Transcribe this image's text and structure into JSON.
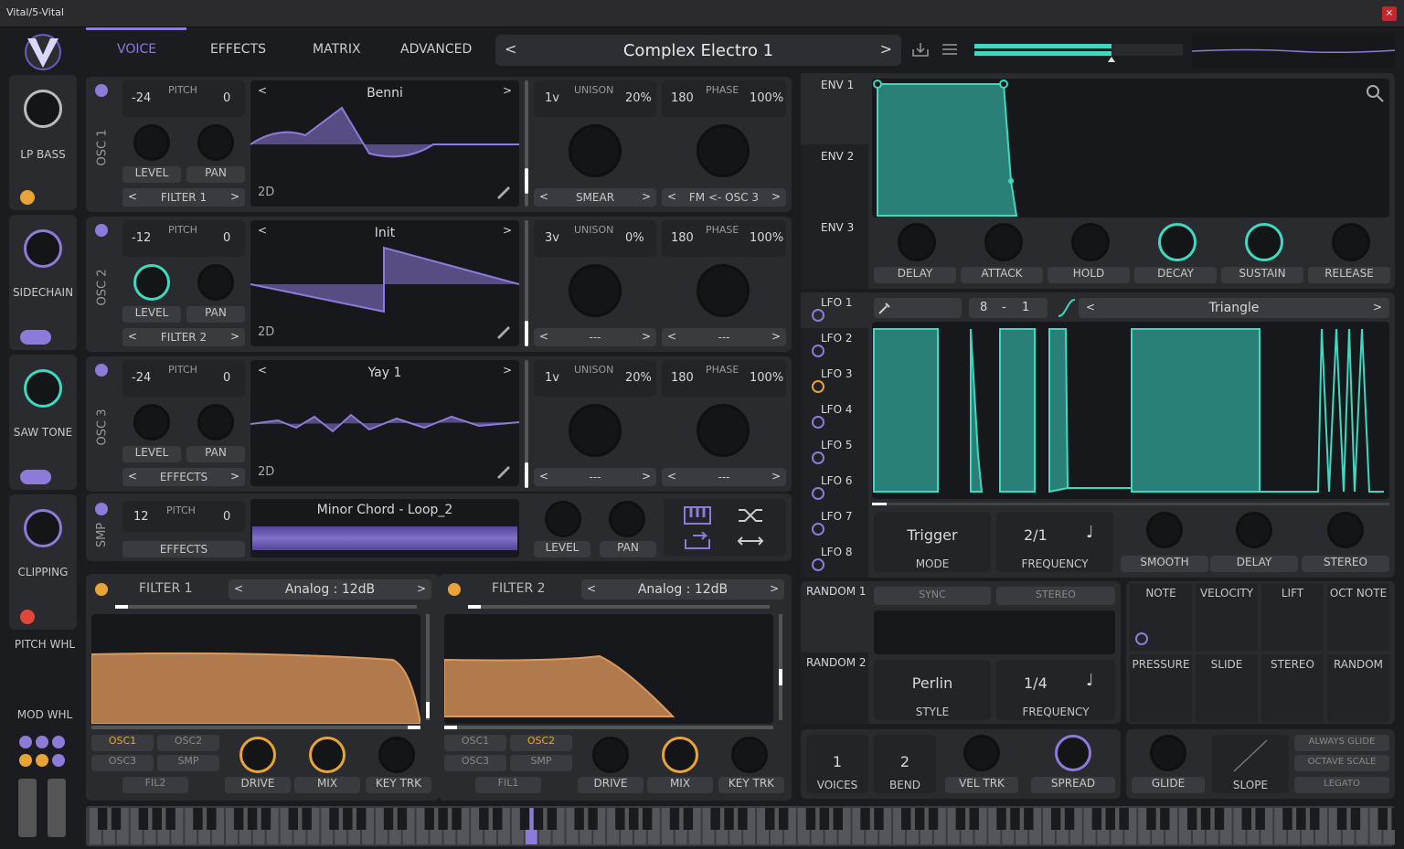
{
  "window": {
    "title": "Vital/5-Vital",
    "close": "×"
  },
  "header": {
    "tabs": [
      "VOICE",
      "EFFECTS",
      "MATRIX",
      "ADVANCED"
    ],
    "active_tab": "VOICE",
    "preset": "Complex Electro 1",
    "prev": "<",
    "next": ">"
  },
  "macros": [
    {
      "label": "LP BASS",
      "color": "#e9a437"
    },
    {
      "label": "SIDECHAIN",
      "color": "#8e7ad8"
    },
    {
      "label": "SAW TONE",
      "color": "#8e7ad8"
    },
    {
      "label": "CLIPPING",
      "color": "#e0463a"
    }
  ],
  "wheels": {
    "pitch": "PITCH WHL",
    "mod": "MOD WHL"
  },
  "oscillators": [
    {
      "id": "OSC 1",
      "pitch_lo": "-24",
      "pitch_label": "PITCH",
      "pitch_hi": "0",
      "level": "LEVEL",
      "pan": "PAN",
      "route": "FILTER 1",
      "wavetable": "Benni",
      "mode": "2D",
      "unison_voices": "1v",
      "unison_label": "UNISON",
      "unison_detune": "20%",
      "phase_lo": "180",
      "phase_label": "PHASE",
      "phase_hi": "100%",
      "smear": "SMEAR",
      "fm": "FM <- OSC 3"
    },
    {
      "id": "OSC 2",
      "pitch_lo": "-12",
      "pitch_label": "PITCH",
      "pitch_hi": "0",
      "level": "LEVEL",
      "pan": "PAN",
      "route": "FILTER 2",
      "wavetable": "Init",
      "mode": "2D",
      "unison_voices": "3v",
      "unison_label": "UNISON",
      "unison_detune": "0%",
      "phase_lo": "180",
      "phase_label": "PHASE",
      "phase_hi": "100%",
      "smear": "---",
      "fm": "---"
    },
    {
      "id": "OSC 3",
      "pitch_lo": "-24",
      "pitch_label": "PITCH",
      "pitch_hi": "0",
      "level": "LEVEL",
      "pan": "PAN",
      "route": "EFFECTS",
      "wavetable": "Yay 1",
      "mode": "2D",
      "unison_voices": "1v",
      "unison_label": "UNISON",
      "unison_detune": "20%",
      "phase_lo": "180",
      "phase_label": "PHASE",
      "phase_hi": "100%",
      "smear": "---",
      "fm": "---"
    }
  ],
  "sample": {
    "id": "SMP",
    "pitch_lo": "12",
    "pitch_label": "PITCH",
    "pitch_hi": "0",
    "route": "EFFECTS",
    "name": "Minor Chord - Loop_2",
    "level": "LEVEL",
    "pan": "PAN"
  },
  "filters": [
    {
      "title": "FILTER 1",
      "type": "Analog : 12dB",
      "osc1": "OSC1",
      "osc2": "OSC2",
      "osc3": "OSC3",
      "smp": "SMP",
      "fil": "FIL2",
      "drive": "DRIVE",
      "mix": "MIX",
      "keytrk": "KEY TRK"
    },
    {
      "title": "FILTER 2",
      "type": "Analog : 12dB",
      "osc1": "OSC1",
      "osc2": "OSC2",
      "osc3": "OSC3",
      "smp": "SMP",
      "fil": "FIL1",
      "drive": "DRIVE",
      "mix": "MIX",
      "keytrk": "KEY TRK"
    }
  ],
  "envelopes": {
    "tabs": [
      "ENV 1",
      "ENV 2",
      "ENV 3"
    ],
    "knobs": [
      "DELAY",
      "ATTACK",
      "HOLD",
      "DECAY",
      "SUSTAIN",
      "RELEASE"
    ]
  },
  "lfos": {
    "tabs": [
      "LFO 1",
      "LFO 2",
      "LFO 3",
      "LFO 4",
      "LFO 5",
      "LFO 6",
      "LFO 7",
      "LFO 8"
    ],
    "grid_x": "8",
    "dash": "-",
    "grid_y": "1",
    "shape": "Triangle",
    "mode_value": "Trigger",
    "mode_label": "MODE",
    "freq_value": "2/1",
    "freq_label": "FREQUENCY",
    "smooth": "SMOOTH",
    "delay": "DELAY",
    "stereo": "STEREO"
  },
  "random": {
    "tabs": [
      "RANDOM 1",
      "RANDOM 2"
    ],
    "sync": "SYNC",
    "stereo": "STEREO",
    "style_value": "Perlin",
    "style_label": "STYLE",
    "freq_value": "1/4",
    "freq_label": "FREQUENCY"
  },
  "mods": {
    "row1": [
      "NOTE",
      "VELOCITY",
      "LIFT",
      "OCT NOTE"
    ],
    "row2": [
      "PRESSURE",
      "SLIDE",
      "STEREO",
      "RANDOM"
    ]
  },
  "voice": {
    "voices_value": "1",
    "voices_label": "VOICES",
    "bend_value": "2",
    "bend_label": "BEND",
    "veltrk": "VEL TRK",
    "spread": "SPREAD"
  },
  "glide": {
    "glide": "GLIDE",
    "slope": "SLOPE",
    "always": "ALWAYS GLIDE",
    "octave": "OCTAVE SCALE",
    "legato": "LEGATO"
  },
  "colors": {
    "accent": "#8e7ad8",
    "teal": "#3fd8c0",
    "orange": "#e9a437",
    "filter_fill": "#b07a4c"
  }
}
